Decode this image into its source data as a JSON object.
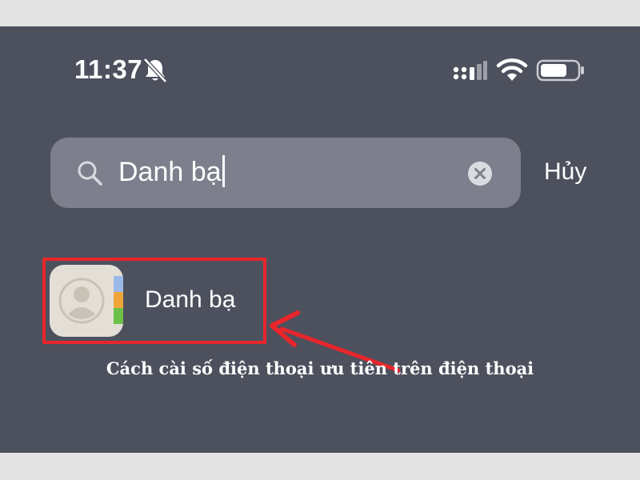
{
  "status_bar": {
    "time": "11:37",
    "icons": [
      "bell-slash-icon",
      "cellular-signal-icon",
      "wifi-icon",
      "battery-icon"
    ]
  },
  "search": {
    "query": "Danh bạ",
    "cancel_label": "Hủy",
    "icons": [
      "search-icon",
      "clear-icon"
    ]
  },
  "results": [
    {
      "label": "Danh bạ",
      "icon": "contacts-app-icon"
    }
  ],
  "caption": "Cách cài số điện thoại ưu tiên trên điện thoại",
  "colors": {
    "background": "#4d515e",
    "search_field": "#7d808c",
    "highlight": "#e8262b",
    "page_border": "#e4e4e4"
  }
}
